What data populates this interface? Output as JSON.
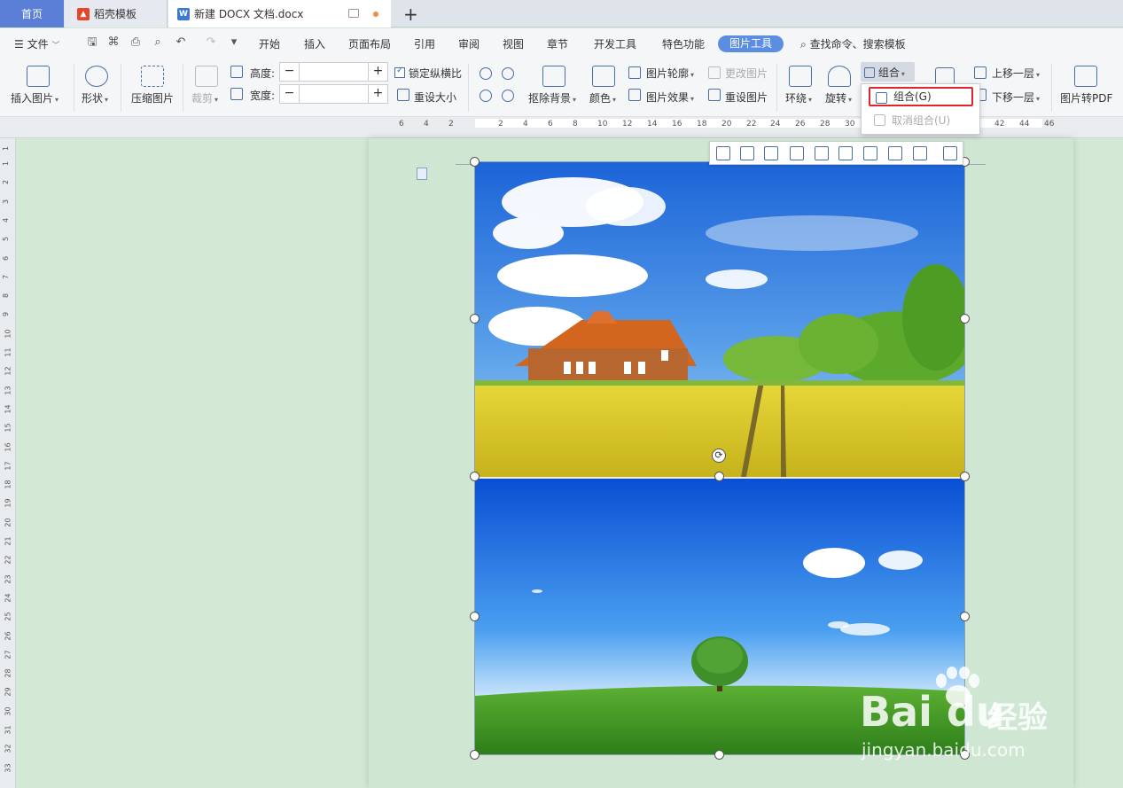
{
  "tabs": {
    "home": "首页",
    "template": "稻壳模板",
    "document": "新建 DOCX 文档.docx",
    "new_tab": "+"
  },
  "menu": {
    "file": "文件",
    "items": [
      "开始",
      "插入",
      "页面布局",
      "引用",
      "审阅",
      "视图",
      "章节",
      "开发工具",
      "特色功能"
    ],
    "active": "图片工具",
    "search": "查找命令、搜索模板"
  },
  "ribbon": {
    "insert_picture": "插入图片",
    "shape": "形状",
    "compress": "压缩图片",
    "crop": "裁剪",
    "height_label": "高度:",
    "width_label": "宽度:",
    "minus": "−",
    "plus": "+",
    "lock_ratio": "锁定纵横比",
    "reset_size": "重设大小",
    "remove_bg": "抠除背景",
    "color": "颜色",
    "picture_outline": "图片轮廓",
    "picture_effect": "图片效果",
    "change_picture": "更改图片",
    "reset_picture": "重设图片",
    "wrap": "环绕",
    "rotate": "旋转",
    "group": "组合",
    "bring_forward": "上移一层",
    "send_backward": "下移一层",
    "to_pdf": "图片转PDF"
  },
  "dropdown": {
    "group": "组合(G)",
    "ungroup": "取消组合(U)"
  },
  "ruler": {
    "h_numbers": [
      "6",
      "4",
      "2",
      "2",
      "4",
      "6",
      "8",
      "10",
      "12",
      "14",
      "16",
      "18",
      "20",
      "22",
      "24",
      "26",
      "28",
      "30",
      "42",
      "44",
      "46"
    ],
    "v_numbers": [
      "1",
      "1",
      "2",
      "3",
      "4",
      "5",
      "6",
      "7",
      "8",
      "9",
      "10",
      "11",
      "12",
      "13",
      "14",
      "15",
      "16",
      "17",
      "18",
      "19",
      "20",
      "21",
      "22",
      "23",
      "24",
      "25",
      "26",
      "27",
      "28",
      "29",
      "30",
      "31",
      "32",
      "33"
    ]
  },
  "watermark": {
    "brand": "Bai du",
    "cn": "经验",
    "url": "jingyan.baidu.com"
  },
  "colors": {
    "accent": "#5b8de0",
    "highlight_box": "#e0262b",
    "workspace": "#d4e8d6"
  }
}
